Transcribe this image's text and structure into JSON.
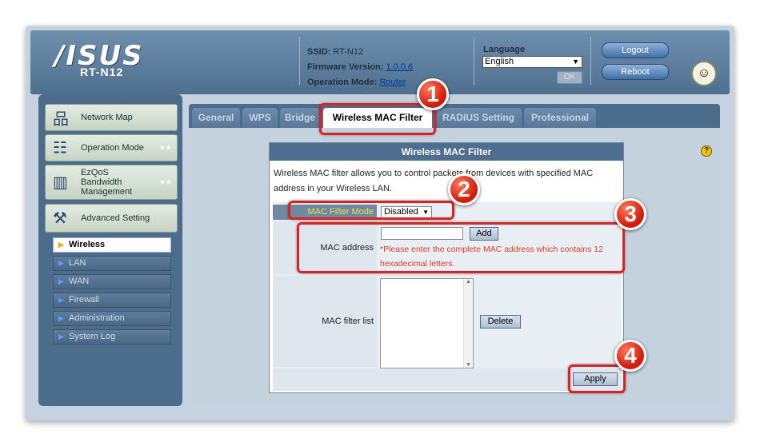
{
  "header": {
    "brand": "/ISUS",
    "model": "RT-N12",
    "ssid_label": "SSID:",
    "ssid_value": "RT-N12",
    "firmware_label": "Firmware Version:",
    "firmware_value": "1.0.0.6",
    "opmode_label": "Operation Mode:",
    "opmode_value": "Router",
    "language_label": "Language",
    "language_value": "English",
    "ok_label": "OK",
    "logout_label": "Logout",
    "reboot_label": "Reboot"
  },
  "sidebar": {
    "menu": [
      {
        "label": "Network Map",
        "icon": "network-map-icon"
      },
      {
        "label": "Operation Mode",
        "icon": "operation-mode-icon"
      },
      {
        "label": "EzQoS Bandwidth Management",
        "label_lines": [
          "EzQoS",
          "Bandwidth",
          "Management"
        ],
        "icon": "qos-icon"
      },
      {
        "label": "Advanced Setting",
        "icon": "advanced-setting-icon"
      }
    ],
    "submenu": [
      {
        "label": "Wireless",
        "active": true
      },
      {
        "label": "LAN",
        "active": false
      },
      {
        "label": "WAN",
        "active": false
      },
      {
        "label": "Firewall",
        "active": false
      },
      {
        "label": "Administration",
        "active": false
      },
      {
        "label": "System Log",
        "active": false
      }
    ]
  },
  "tabs": [
    {
      "label": "General",
      "active": false
    },
    {
      "label": "WPS",
      "active": false
    },
    {
      "label": "Bridge",
      "active": false
    },
    {
      "label": "Wireless MAC Filter",
      "active": true
    },
    {
      "label": "RADIUS Setting",
      "active": false
    },
    {
      "label": "Professional",
      "active": false
    }
  ],
  "panel": {
    "title": "Wireless MAC Filter",
    "description": "Wireless MAC filter allows you to control packets from devices with specified MAC address in your Wireless LAN.",
    "filter_mode_label": "MAC Filter Mode",
    "filter_mode_value": "Disabled",
    "mac_address_label": "MAC address",
    "mac_address_value": "",
    "add_label": "Add",
    "mac_hint": "*Please enter the complete MAC address which contains 12 hexadecimal letters.",
    "filter_list_label": "MAC filter list",
    "delete_label": "Delete",
    "apply_label": "Apply"
  },
  "annotations": {
    "step1": "1",
    "step2": "2",
    "step3": "3",
    "step4": "4",
    "highlight_color": "#dd2222"
  },
  "help_label": "?"
}
